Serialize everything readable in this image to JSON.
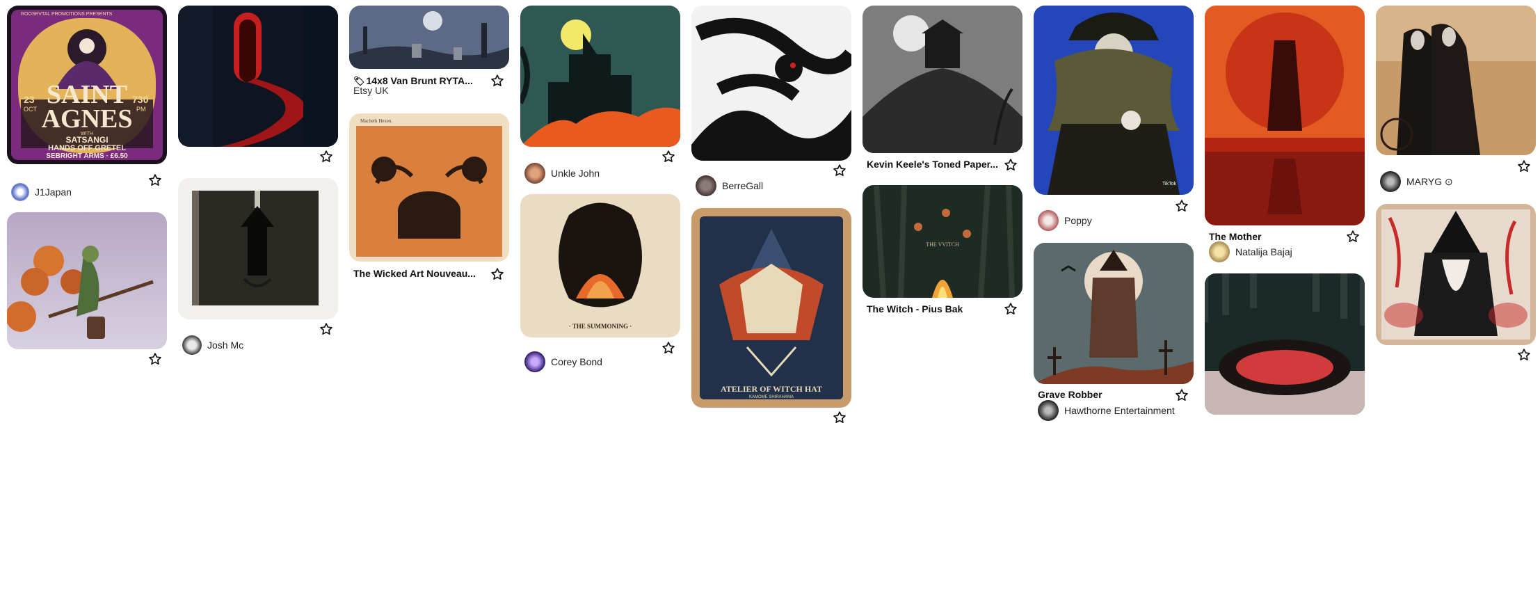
{
  "pins": {
    "p1": {
      "user": "J1Japan",
      "poster": {
        "top": "ROOSEVTAL PROMOTIONS PRESENTS",
        "title1": "SAINT",
        "title2": "AGNES",
        "date_day": "23",
        "date_month": "OCT",
        "time": "730",
        "time_unit": "PM",
        "with": "WITH",
        "line1": "SATSANGI",
        "line2": "HANDS OFF GRETEL",
        "line3": "SEBRIGHT ARMS · £6.50"
      }
    },
    "p2": {
      "user": "Josh Mc"
    },
    "p3": {
      "title": "14x8 Van Brunt RYTA...",
      "subtitle": "Etsy UK"
    },
    "p4": {
      "title": "The Wicked Art Nouveau...",
      "header_left": "Macbeth Hexen."
    },
    "p5": {
      "user": "Unkle John"
    },
    "p6": {
      "user": "Corey Bond",
      "caption": "· THE SUMMONING ·"
    },
    "p7": {
      "user": "BerreGall"
    },
    "p8": {
      "caption": "ATELIER OF WITCH HAT",
      "caption2": "KAMOME SHIRAHAMA"
    },
    "p9": {
      "title": "Kevin Keele's Toned Paper..."
    },
    "p10": {
      "title": "The Witch - Pius Bak",
      "overlay": "THE VVITCH"
    },
    "p11": {
      "user": "Poppy",
      "watermark": "TikTok"
    },
    "p12": {
      "title": "Grave Robber",
      "user": "Hawthorne Entertainment"
    },
    "p13": {
      "title": "The Mother",
      "user": "Natalija Bajaj"
    },
    "p15": {
      "user": "MARYG ⊙"
    }
  },
  "icons": {
    "save": "star-outline-icon",
    "tag": "tag-icon"
  },
  "colors": {
    "text": "#111111",
    "muted": "#333333",
    "background": "#ffffff"
  }
}
